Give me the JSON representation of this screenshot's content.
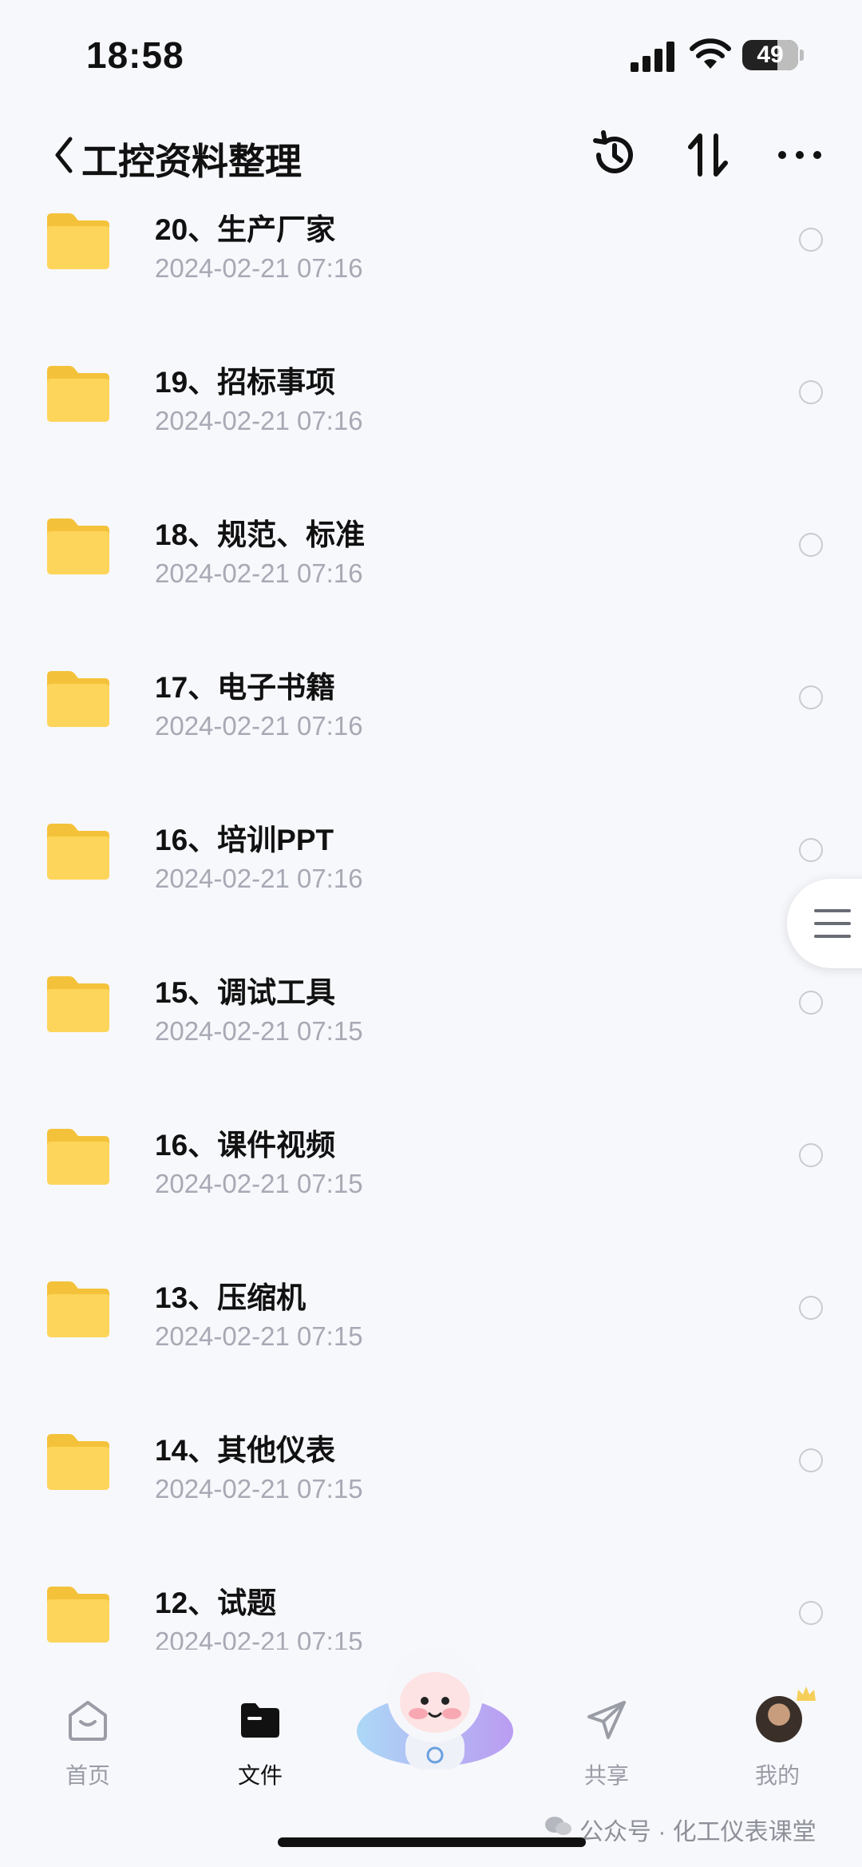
{
  "status_bar": {
    "time": "18:58",
    "battery": "49"
  },
  "header": {
    "title": "工控资料整理"
  },
  "folders": [
    {
      "name": "20、生产厂家",
      "date": "2024-02-21 07:16"
    },
    {
      "name": "19、招标事项",
      "date": "2024-02-21 07:16"
    },
    {
      "name": "18、规范、标准",
      "date": "2024-02-21 07:16"
    },
    {
      "name": "17、电子书籍",
      "date": "2024-02-21 07:16"
    },
    {
      "name": "16、培训PPT",
      "date": "2024-02-21 07:16"
    },
    {
      "name": "15、调试工具",
      "date": "2024-02-21 07:15"
    },
    {
      "name": "16、课件视频",
      "date": "2024-02-21 07:15"
    },
    {
      "name": "13、压缩机",
      "date": "2024-02-21 07:15"
    },
    {
      "name": "14、其他仪表",
      "date": "2024-02-21 07:15"
    },
    {
      "name": "12、试题",
      "date": "2024-02-21 07:15"
    }
  ],
  "nav": {
    "home": "首页",
    "files": "文件",
    "share": "共享",
    "mine": "我的"
  },
  "watermark": "公众号 · 化工仪表课堂",
  "colors": {
    "folder": "#fcd14a",
    "accent": "#111111",
    "muted": "#a7a9b4"
  }
}
